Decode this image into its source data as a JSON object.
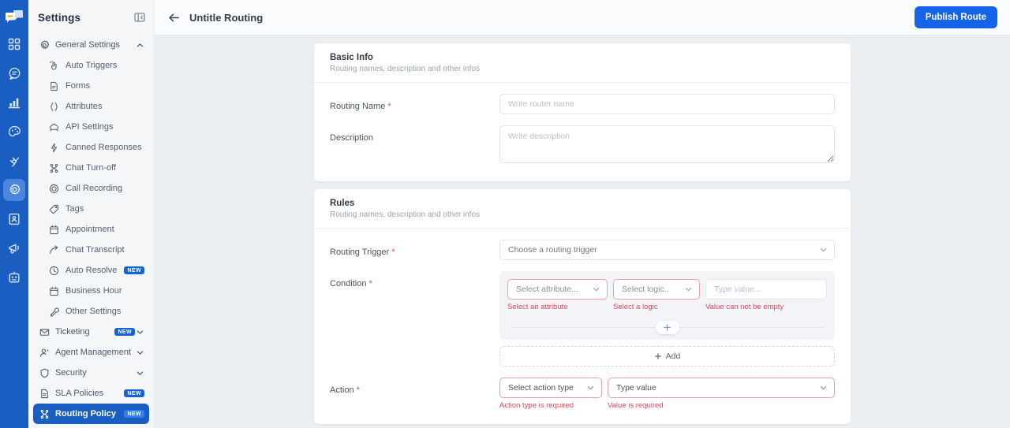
{
  "brand": {
    "rail_bg": "#1b5ec2",
    "rail_active_bg": "#4a86dd",
    "accent": "#1564e8",
    "error": "#e0475b",
    "badge_bg": "#1564d4"
  },
  "rail": {
    "logo_name": "chatbot-logo",
    "items": [
      {
        "icon": "dashboard-grid-icon",
        "active": false
      },
      {
        "icon": "chat-bubble-icon",
        "active": false
      },
      {
        "icon": "bar-chart-icon",
        "active": false
      },
      {
        "icon": "palette-icon",
        "active": false
      },
      {
        "icon": "plug-integration-icon",
        "active": false
      },
      {
        "icon": "gear-settings-icon",
        "active": true
      },
      {
        "icon": "contact-card-icon",
        "active": false
      },
      {
        "icon": "megaphone-icon",
        "active": false
      },
      {
        "icon": "robot-icon",
        "active": false
      }
    ]
  },
  "sidebar": {
    "title": "Settings",
    "collapse_icon": "collapse-panel-icon",
    "items": [
      {
        "label": "General Settings",
        "icon": "gear-icon",
        "level": "group",
        "chevron": "chevron-up-icon",
        "badge": "",
        "active": false
      },
      {
        "label": "Auto Triggers",
        "icon": "auto-triggers-icon",
        "level": "child",
        "chevron": "",
        "badge": "",
        "active": false
      },
      {
        "label": "Forms",
        "icon": "form-document-icon",
        "level": "child",
        "chevron": "",
        "badge": "",
        "active": false
      },
      {
        "label": "Attributes",
        "icon": "braces-icon",
        "level": "child",
        "chevron": "",
        "badge": "",
        "active": false
      },
      {
        "label": "API Settings",
        "icon": "cloud-api-icon",
        "level": "child",
        "chevron": "",
        "badge": "",
        "active": false
      },
      {
        "label": "Canned Responses",
        "icon": "lightning-bolt-icon",
        "level": "child",
        "chevron": "",
        "badge": "",
        "active": false
      },
      {
        "label": "Chat Turn-off",
        "icon": "routing-nodes-icon",
        "level": "child",
        "chevron": "",
        "badge": "",
        "active": false
      },
      {
        "label": "Call Recording",
        "icon": "record-circle-icon",
        "level": "child",
        "chevron": "",
        "badge": "",
        "active": false
      },
      {
        "label": "Tags",
        "icon": "tag-icon",
        "level": "child",
        "chevron": "",
        "badge": "",
        "active": false
      },
      {
        "label": "Appointment",
        "icon": "calendar-icon",
        "level": "child",
        "chevron": "",
        "badge": "",
        "active": false
      },
      {
        "label": "Chat Transcript",
        "icon": "arrow-share-icon",
        "level": "child",
        "chevron": "",
        "badge": "",
        "active": false
      },
      {
        "label": "Auto Resolve",
        "icon": "clock-icon",
        "level": "child",
        "chevron": "",
        "badge": "NEW",
        "active": false
      },
      {
        "label": "Business Hour",
        "icon": "calendar-icon",
        "level": "child",
        "chevron": "",
        "badge": "",
        "active": false
      },
      {
        "label": "Other Settings",
        "icon": "wrench-icon",
        "level": "child",
        "chevron": "",
        "badge": "",
        "active": false
      },
      {
        "label": "Ticketing",
        "icon": "envelope-icon",
        "level": "group",
        "chevron": "chevron-down-icon",
        "badge": "NEW",
        "active": false
      },
      {
        "label": "Agent Management",
        "icon": "user-settings-icon",
        "level": "group",
        "chevron": "chevron-down-icon",
        "badge": "",
        "active": false
      },
      {
        "label": "Security",
        "icon": "shield-icon",
        "level": "group",
        "chevron": "chevron-down-icon",
        "badge": "",
        "active": false
      },
      {
        "label": "SLA Policies",
        "icon": "policy-document-icon",
        "level": "group",
        "chevron": "",
        "badge": "NEW",
        "active": false
      },
      {
        "label": "Routing Policy",
        "icon": "routing-nodes-icon",
        "level": "group",
        "chevron": "",
        "badge": "NEW",
        "active": true
      }
    ]
  },
  "topbar": {
    "back_icon": "arrow-left-icon",
    "title": "Untitle Routing",
    "publish_label": "Publish Route"
  },
  "basic_info": {
    "heading": "Basic Info",
    "subheading": "Routing names, description and other infos",
    "routing_name_label": "Routing Name",
    "routing_name_required": "*",
    "routing_name_value": "",
    "routing_name_placeholder": "Write router name",
    "description_label": "Description",
    "description_value": "",
    "description_placeholder": "Write description"
  },
  "rules": {
    "heading": "Rules",
    "subheading": "Routing names, description and other infos",
    "trigger_label": "Routing Trigger",
    "trigger_required": "*",
    "trigger_value": "Choose a routing trigger",
    "condition_label": "Condition",
    "condition_required": "*",
    "condition": {
      "attribute_value": "Select attribute...",
      "logic_value": "Select logic..",
      "value_placeholder": "Type value...",
      "value_value": "",
      "attribute_error": "Select an attribute",
      "logic_error": "Select a logic",
      "value_error": "Value can not be empty",
      "add_row_icon": "plus-icon"
    },
    "add_condition_label": "Add",
    "add_condition_icon": "plus-icon",
    "action_label": "Action",
    "action_required": "*",
    "action": {
      "type_value": "Select action type",
      "value_value": "Type value",
      "type_error": "Action type is required",
      "value_error": "Value is required"
    }
  }
}
